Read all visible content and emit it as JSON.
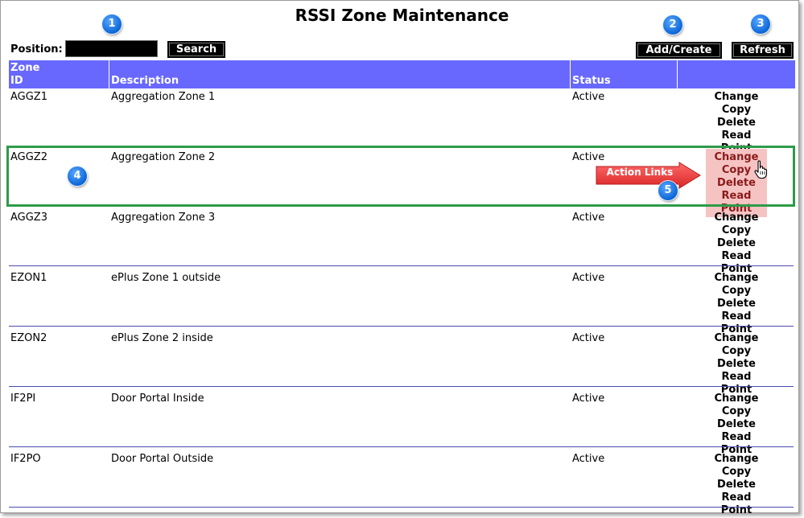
{
  "page": {
    "title": "RSSI Zone Maintenance"
  },
  "toolbar": {
    "position_label": "Position:",
    "position_value": "",
    "search_label": "Search",
    "add_label": "Add/Create",
    "refresh_label": "Refresh"
  },
  "table": {
    "headers": {
      "zone_id": "Zone ID",
      "zone_id_line1": "Zone",
      "zone_id_line2": "ID",
      "description": "Description",
      "status": "Status",
      "actions": ""
    },
    "action_labels": {
      "change": "Change",
      "copy": "Copy",
      "delete": "Delete",
      "read_point": "Read Point"
    },
    "rows": [
      {
        "zone_id": "AGGZ1",
        "description": "Aggregation Zone 1",
        "status": "Active"
      },
      {
        "zone_id": "AGGZ2",
        "description": "Aggregation Zone 2",
        "status": "Active"
      },
      {
        "zone_id": "AGGZ3",
        "description": "Aggregation Zone 3",
        "status": "Active"
      },
      {
        "zone_id": "EZON1",
        "description": "ePlus Zone 1 outside",
        "status": "Active"
      },
      {
        "zone_id": "EZON2",
        "description": "ePlus Zone 2 inside",
        "status": "Active"
      },
      {
        "zone_id": "IF2PI",
        "description": "Door Portal Inside",
        "status": "Active"
      },
      {
        "zone_id": "IF2PO",
        "description": "Door Portal Outside",
        "status": "Active"
      }
    ]
  },
  "annotations": {
    "badges": [
      "1",
      "2",
      "3",
      "4",
      "5"
    ],
    "callout_text": "Action Links"
  },
  "colors": {
    "header_bg": "#6868ff",
    "row_separator": "#4b4bb0",
    "highlight_border": "#2e9b4a",
    "callout_red": "#e63c3c",
    "hover_bg": "#f6c3c3",
    "badge_blue": "#0b66d6"
  }
}
